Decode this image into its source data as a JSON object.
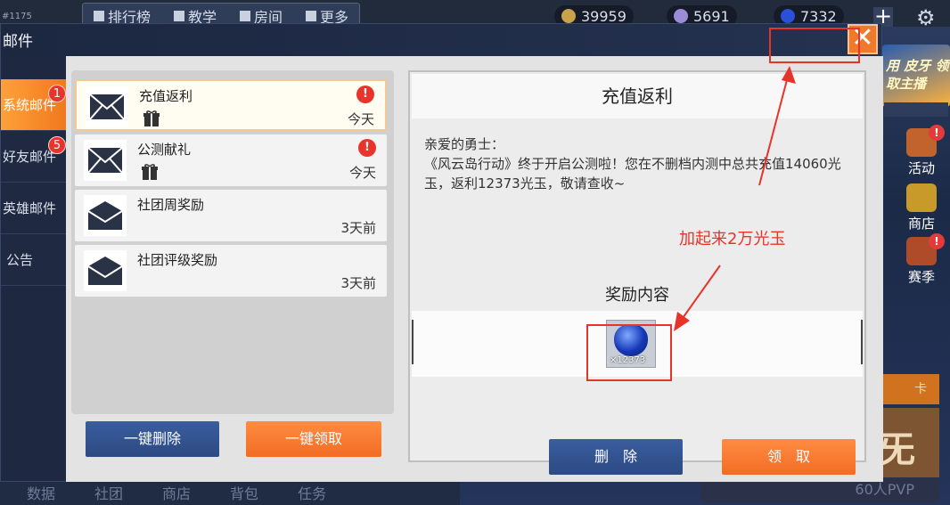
{
  "game_bg": {
    "uid": "#1175",
    "nav": [
      "排行榜",
      "教学",
      "房间",
      "更多"
    ],
    "resources": [
      {
        "value": "39959",
        "color": "#c9a24a"
      },
      {
        "value": "5691",
        "color": "#9c8bd6"
      },
      {
        "value": "7332",
        "color": "#2a4fd8"
      }
    ],
    "promo_text": "用 皮牙\n领取主播",
    "side_buttons": [
      {
        "label": "活动",
        "color": "#c2632d"
      },
      {
        "label": "商店",
        "color": "#c79a2a"
      },
      {
        "label": "赛季",
        "color": "#b04b2a"
      }
    ],
    "card_text": "卡",
    "card_big": "旡",
    "pvp_label": "60人PVP",
    "bottom_tabs": [
      "数据",
      "社团",
      "商店",
      "背包",
      "任务"
    ]
  },
  "modal": {
    "title": "邮件",
    "close_symbol": "✕",
    "categories": [
      {
        "label": "系统邮件",
        "badge": "1",
        "active": true
      },
      {
        "label": "好友邮件",
        "badge": "5",
        "active": false
      },
      {
        "label": "英雄邮件",
        "badge": "",
        "active": false
      },
      {
        "label": "公告",
        "badge": "",
        "active": false
      }
    ],
    "mails": [
      {
        "title": "充值返利",
        "time": "今天",
        "has_gift": true,
        "alert": "!"
      },
      {
        "title": "公测献礼",
        "time": "今天",
        "has_gift": true,
        "alert": "!"
      },
      {
        "title": "社团周奖励",
        "time": "3天前",
        "has_gift": false,
        "alert": ""
      },
      {
        "title": "社团评级奖励",
        "time": "3天前",
        "has_gift": false,
        "alert": ""
      }
    ],
    "delete_all_label": "一键删除",
    "claim_all_label": "一键领取",
    "detail": {
      "title": "充值返利",
      "greeting": "亲爱的勇士：",
      "body": "《风云岛行动》终于开启公测啦！您在不删档内测中总共充值14060光玉，返利12373光玉，敬请查收~",
      "reward_label": "奖励内容",
      "reward_count": "×12373",
      "delete_label": "删　除",
      "claim_label": "领　取"
    }
  },
  "annotation": {
    "text": "加起来2万光玉",
    "color": "#e8332a"
  }
}
